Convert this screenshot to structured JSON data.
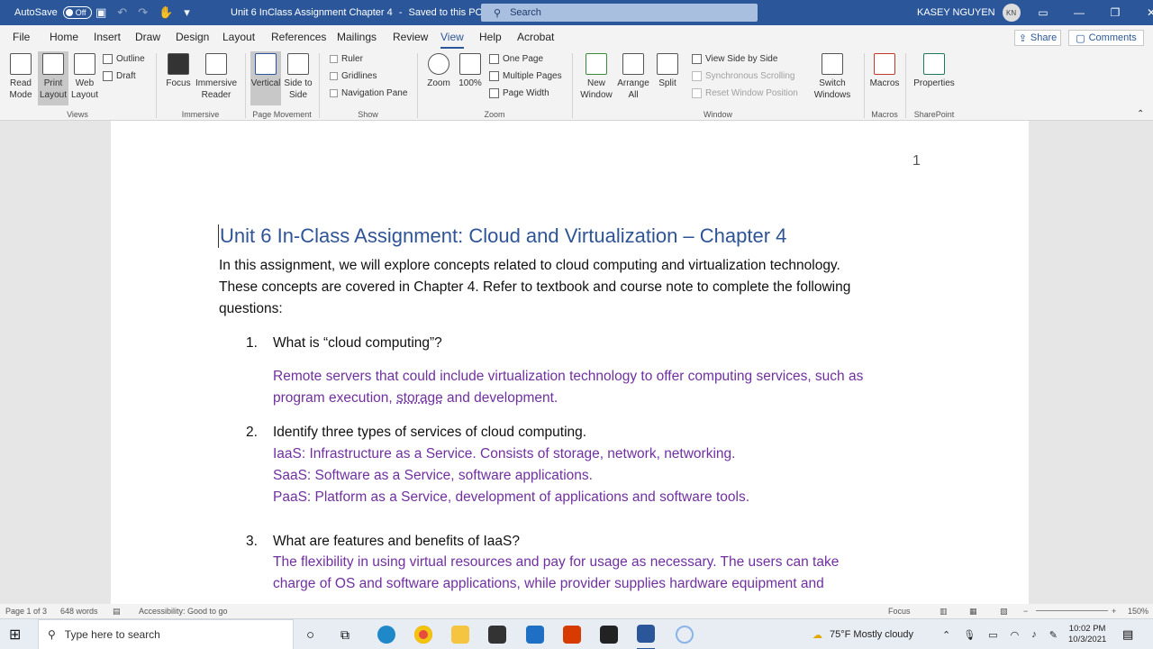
{
  "titlebar": {
    "autosave_label": "AutoSave",
    "autosave_state": "Off",
    "document_title": "Unit 6 InClass Assignment Chapter 4",
    "save_status": "Saved to this PC",
    "search_placeholder": "Search",
    "user_name": "KASEY NGUYEN",
    "user_initials": "KN"
  },
  "menu_tabs": [
    "File",
    "Home",
    "Insert",
    "Draw",
    "Design",
    "Layout",
    "References",
    "Mailings",
    "Review",
    "View",
    "Help",
    "Acrobat"
  ],
  "active_tab": "View",
  "share_label": "Share",
  "comments_label": "Comments",
  "ribbon": {
    "views": {
      "read_mode": "Read Mode",
      "print_layout": "Print Layout",
      "web_layout": "Web Layout",
      "outline": "Outline",
      "draft": "Draft",
      "group": "Views"
    },
    "immersive": {
      "focus": "Focus",
      "immersive_reader": "Immersive Reader",
      "group": "Immersive"
    },
    "page_movement": {
      "vertical": "Vertical",
      "side_to_side": "Side to Side",
      "group": "Page Movement"
    },
    "show": {
      "ruler": "Ruler",
      "gridlines": "Gridlines",
      "navigation_pane": "Navigation Pane",
      "group": "Show"
    },
    "zoom": {
      "zoom": "Zoom",
      "hundred": "100%",
      "one_page": "One Page",
      "multiple_pages": "Multiple Pages",
      "page_width": "Page Width",
      "group": "Zoom"
    },
    "window": {
      "new_window": "New Window",
      "arrange_all": "Arrange All",
      "split": "Split",
      "view_side_by_side": "View Side by Side",
      "sync_scrolling": "Synchronous Scrolling",
      "reset_window": "Reset Window Position",
      "switch_windows": "Switch Windows",
      "group": "Window"
    },
    "macros": {
      "macros": "Macros",
      "group": "Macros"
    },
    "sharepoint": {
      "properties": "Properties",
      "group": "SharePoint"
    }
  },
  "document": {
    "page_number": "1",
    "heading": "Unit 6 In-Class Assignment: Cloud and Virtualization – Chapter 4",
    "intro_1": "In this assignment, we will explore concepts related to cloud computing and virtualization technology.",
    "intro_2": "These concepts are covered in Chapter 4. Refer to textbook and course note to complete the following",
    "intro_3": "questions:",
    "q1_num": "1.",
    "q1": "What is “cloud computing”?",
    "a1_line1": "Remote servers that could include virtualization technology to offer computing services, such as",
    "a1_line2_pre": "program execution, ",
    "a1_line2_u": "storage",
    "a1_line2_post": " and development.",
    "q2_num": "2.",
    "q2": "Identify three types of services of cloud computing.",
    "a2_1": "IaaS: Infrastructure as a Service. Consists of storage, network, networking.",
    "a2_2": "SaaS: Software as a Service, software applications.",
    "a2_3": "PaaS: Platform as a Service, development of applications and software tools.",
    "q3_num": "3.",
    "q3": "What are features and benefits of IaaS?",
    "a3_1": "The flexibility in using virtual resources and pay for usage as necessary. The users can take",
    "a3_2": "charge of OS and software applications, while provider supplies hardware equipment and"
  },
  "statusbar": {
    "page": "Page 1 of 3",
    "words": "648 words",
    "accessibility": "Accessibility: Good to go",
    "focus": "Focus",
    "zoom": "150%"
  },
  "taskbar": {
    "search_placeholder": "Type here to search",
    "weather": "75°F  Mostly cloudy",
    "time": "10:02 PM",
    "date": "10/3/2021"
  },
  "colors": {
    "accent": "#2b579a",
    "heading": "#2f5496",
    "answer": "#7030a0"
  }
}
